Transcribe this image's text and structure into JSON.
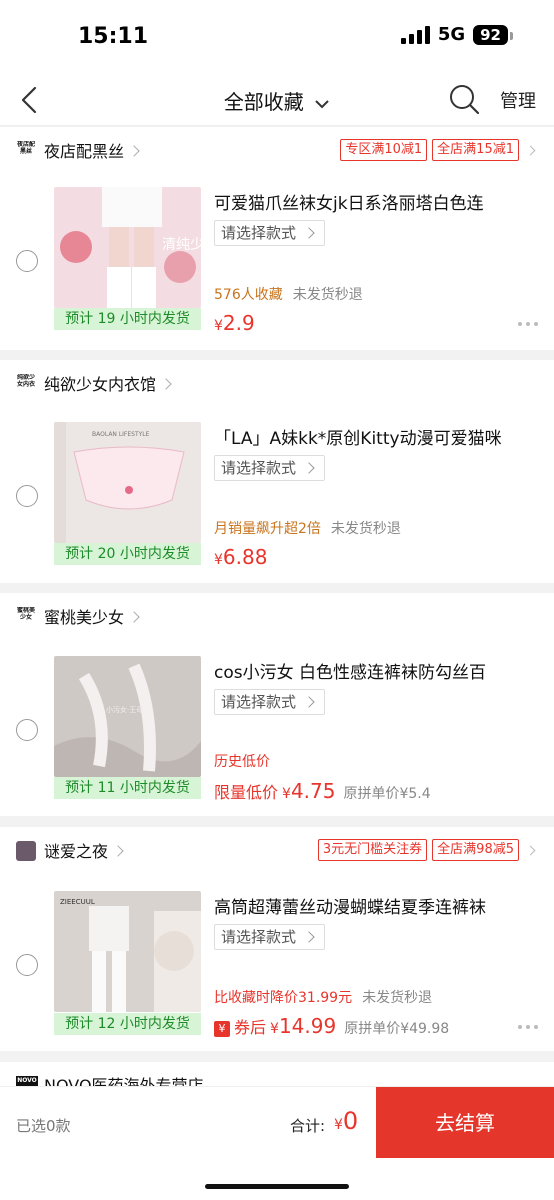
{
  "status": {
    "time": "15:11",
    "network": "5G",
    "battery": "92"
  },
  "nav": {
    "title": "全部收藏",
    "manage": "管理"
  },
  "items": [
    {
      "shop": "夜店配黑丝",
      "shop_logo": "夜店配黑丝",
      "promos": [
        "专区满10减1",
        "全店满15减1"
      ],
      "title": "可爱猫爪丝袜女jk日系洛丽塔白色连",
      "sku": "请选择款式",
      "ship": "预计 19 小时内发货",
      "meta_highlight": "576人收藏",
      "meta_note": "未发货秒退",
      "price_yen": "¥",
      "price": "2.9",
      "image_text": "清纯少女"
    },
    {
      "shop": "纯欲少女内衣馆",
      "shop_logo": "纯欲少女内衣",
      "promos": [],
      "title": "「LA」A妹kk*原创Kitty动漫可爱猫咪",
      "sku": "请选择款式",
      "ship": "预计 20 小时内发货",
      "meta_highlight": "月销量飙升超2倍",
      "meta_note": "未发货秒退",
      "price_yen": "¥",
      "price": "6.88",
      "image_text": "BAOLAN LIFESTYLE"
    },
    {
      "shop": "蜜桃美少女",
      "shop_logo": "蜜桃美少女",
      "promos": [],
      "title": "cos小污女 白色性感连裤袜防勾丝百",
      "sku": "请选择款式",
      "ship": "预计 11 小时内发货",
      "meta_highlight": "历史低价",
      "price_label": "限量低价",
      "price_yen": "¥",
      "price": "4.75",
      "orig_price": "原拼单价¥5.4",
      "image_text": "小污女·王母"
    },
    {
      "shop": "谜爱之夜",
      "shop_logo": "",
      "promos": [
        "3元无门槛关注券",
        "全店满98减5"
      ],
      "title": "高筒超薄蕾丝动漫蝴蝶结夏季连裤袜",
      "sku": "请选择款式",
      "ship": "预计 12 小时内发货",
      "meta_highlight": "比收藏时降价31.99元",
      "meta_note": "未发货秒退",
      "price_label": "券后",
      "price_yen": "¥",
      "price": "14.99",
      "orig_price": "原拼单价¥49.98",
      "image_text": "ZIEECUUL"
    }
  ],
  "next_shop": {
    "shop": "NOVO医药海外专营店",
    "shop_logo": "NOVO"
  },
  "footer": {
    "selected": "已选0款",
    "total_label": "合计:",
    "total_yen": "¥",
    "total": "0",
    "checkout": "去结算"
  },
  "colors": {
    "accent": "#e5362b",
    "ship_bg": "#d8f4d6",
    "ship_text": "#1e8b2a"
  }
}
